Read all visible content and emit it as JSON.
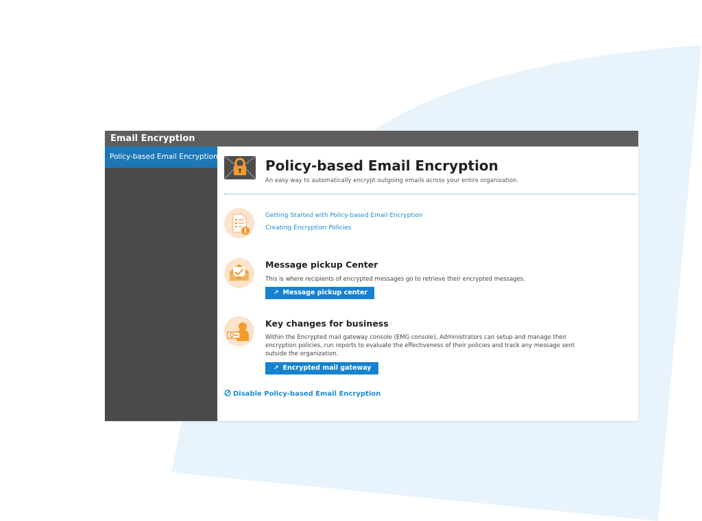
{
  "window": {
    "title": "Email Encryption"
  },
  "sidebar": {
    "items": [
      {
        "label": "Policy-based Email Encryption",
        "active": true
      }
    ]
  },
  "hero": {
    "icon": "lock-envelope-icon",
    "title": "Policy-based Email Encryption",
    "subtitle": "An easy way to automatically encrypt outgoing emails across your entire organization."
  },
  "resources": {
    "icon": "document-info-icon",
    "links": [
      "Getting Started with Policy-based Email Encryption",
      "Creating Encryption Policies"
    ]
  },
  "pickup": {
    "icon": "open-envelope-icon",
    "title": "Message pickup Center",
    "text": "This is where recipients of encrypted messages go to retrieve their encrypted messages.",
    "button_icon": "external-link-icon",
    "button_label": "Message pickup center"
  },
  "business": {
    "icon": "key-person-icon",
    "title": "Key changes for business",
    "text": "Within the Encrypted mail gateway console (EMG console), Administrators can setup and manage their encryption policies, run reports to evaluate the effectiveness of their policies and track any message sent outside the organization.",
    "button_icon": "external-link-icon",
    "button_label": "Encrypted mail gateway"
  },
  "disable": {
    "icon": "ban-icon",
    "label": "Disable Policy-based Email Encryption"
  },
  "colors": {
    "titlebar": "#5e5e5e",
    "sidebar": "#4a4a4a",
    "accent": "#1e78b8",
    "button": "#1682d0",
    "link": "#1e8ad0",
    "icon_bg": "#fbe3cc",
    "icon_orange": "#f39a2b",
    "backdrop": "#e8f3fc"
  }
}
